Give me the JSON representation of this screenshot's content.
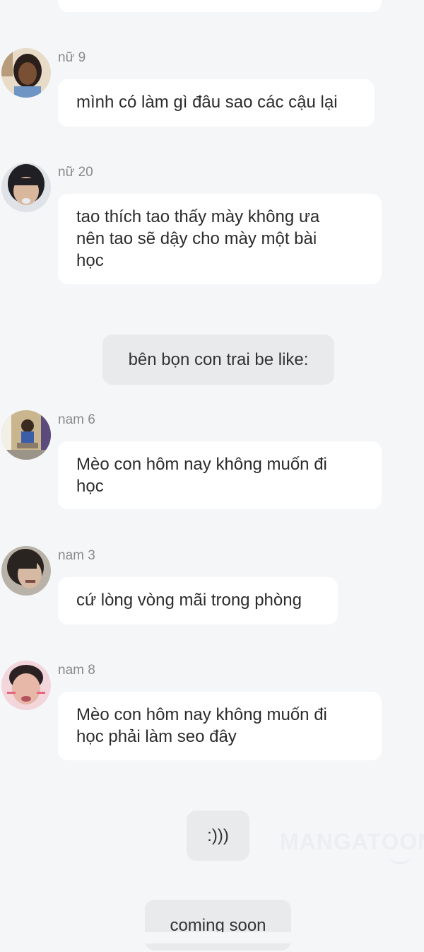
{
  "messages": [
    {
      "name": "nữ 9",
      "text": "mình có làm gì đâu sao các cậu lại"
    },
    {
      "name": "nữ 20",
      "lines": [
        "tao thích tao thấy mày không ưa",
        "nên tao sẽ dậy cho mày một bài",
        "học"
      ]
    },
    {
      "name": "nam 6",
      "lines": [
        "Mèo con hôm nay không muốn đi",
        "học"
      ]
    },
    {
      "name": "nam 3",
      "text": "cứ lòng vòng mãi trong phòng"
    },
    {
      "name": "nam 8",
      "lines": [
        "Mèo con hôm nay không muốn đi",
        "học phải làm seo đây"
      ]
    }
  ],
  "system": {
    "boys_intro": "bên bọn con trai be like:",
    "laugh": ":)))",
    "coming_soon": "coming soon"
  },
  "watermark": "MANGATOON",
  "colors": {
    "background": "#f5f6f8",
    "bubble": "#ffffff",
    "system_bubble": "#e9eaec",
    "name_text": "#8a8a8a"
  }
}
